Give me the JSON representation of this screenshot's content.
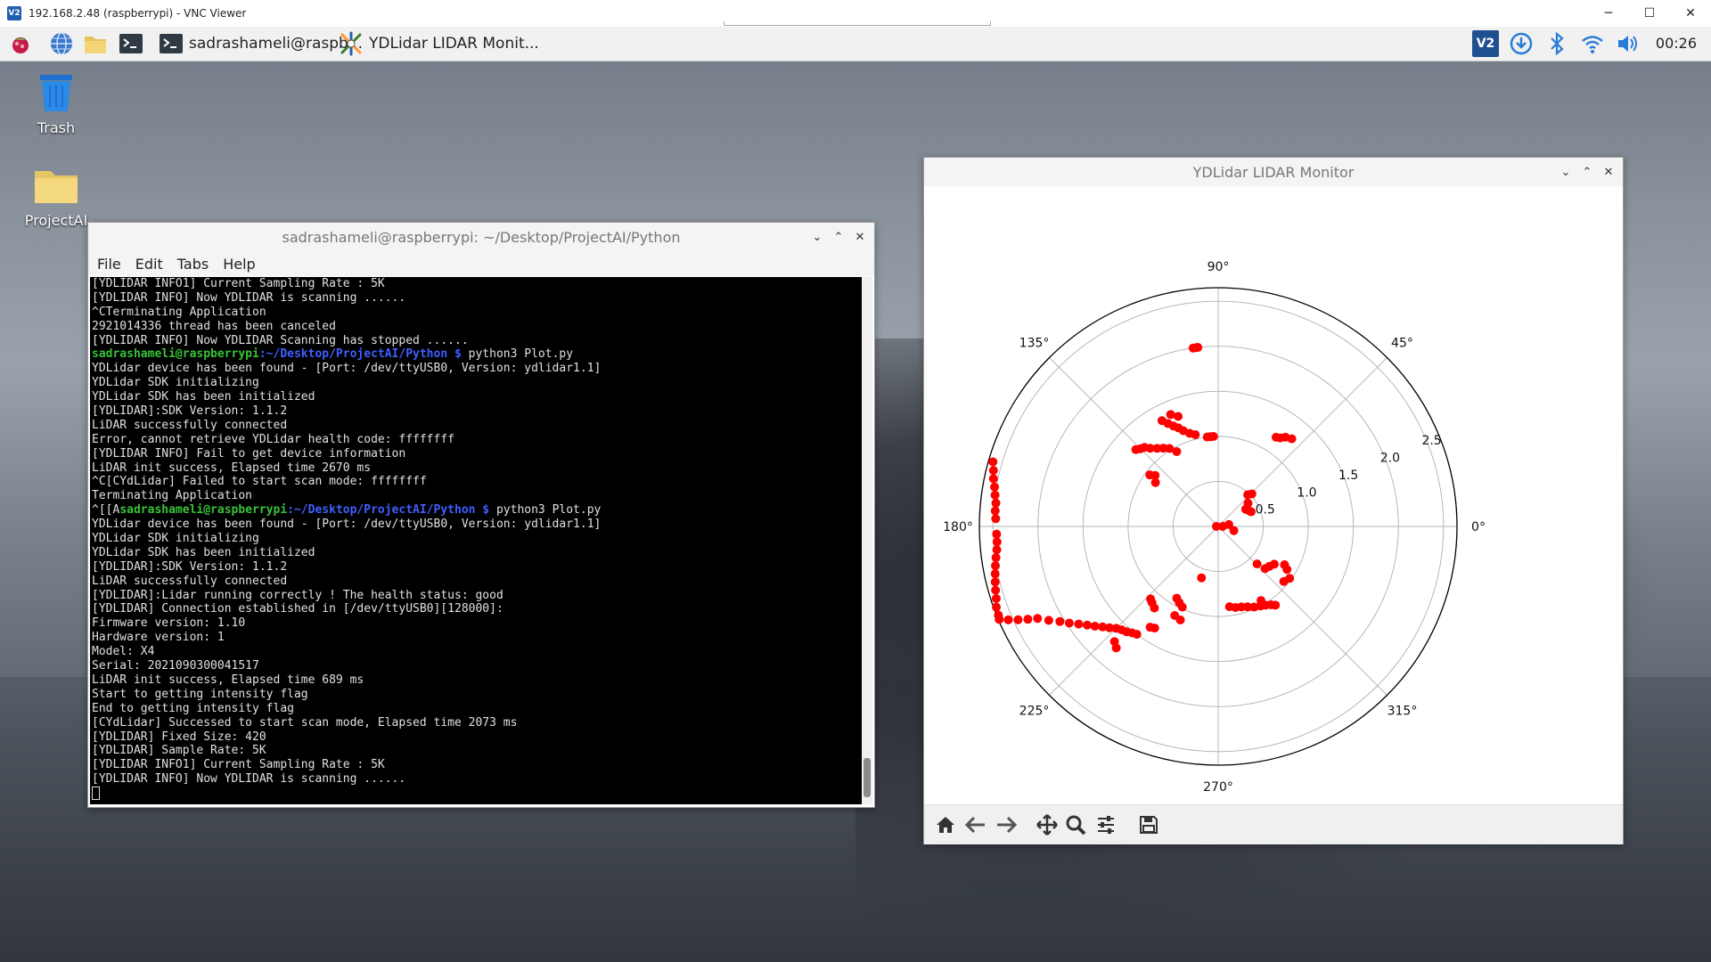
{
  "vnc": {
    "title": "192.168.2.48 (raspberrypi) - VNC Viewer",
    "logo": "V2",
    "controls": [
      "─",
      "☐",
      "✕"
    ]
  },
  "taskbar": {
    "tasks": [
      {
        "label": "sadrashameli@raspb...",
        "icon": "terminal-icon"
      },
      {
        "label": "YDLidar LIDAR Monit...",
        "icon": "python-icon"
      }
    ],
    "clock": "00:26",
    "tray_icons": [
      "vnc-icon",
      "download-icon",
      "bluetooth-icon",
      "wifi-icon",
      "volume-icon"
    ],
    "launcher_icons": [
      "raspberry-menu-icon",
      "browser-icon",
      "file-manager-icon",
      "terminal-launcher-icon"
    ]
  },
  "desktop": {
    "items": [
      {
        "label": "Trash",
        "icon": "trash-icon"
      },
      {
        "label": "ProjectAI",
        "icon": "folder-icon"
      }
    ]
  },
  "terminal": {
    "title": "sadrashameli@raspberrypi: ~/Desktop/ProjectAI/Python",
    "menu": [
      "File",
      "Edit",
      "Tabs",
      "Help"
    ],
    "lines": [
      {
        "text": "[YDLIDAR INFO1] Current Sampling Rate : 5K"
      },
      {
        "text": "[YDLIDAR INFO] Now YDLIDAR is scanning ......"
      },
      {
        "text": "^CTerminating Application"
      },
      {
        "text": "2921014336 thread has been canceled"
      },
      {
        "text": "[YDLIDAR INFO] Now YDLIDAR Scanning has stopped ......"
      },
      {
        "prefix": "",
        "user": "sadrashameli@raspberrypi",
        "path": ":~/Desktop/ProjectAI/Python $",
        "cmd": " python3 Plot.py"
      },
      {
        "text": "YDLidar device has been found - [Port: /dev/ttyUSB0, Version: ydlidar1.1]"
      },
      {
        "text": "YDLidar SDK initializing"
      },
      {
        "text": "YDLidar SDK has been initialized"
      },
      {
        "text": "[YDLIDAR]:SDK Version: 1.1.2"
      },
      {
        "text": "LiDAR successfully connected"
      },
      {
        "text": "Error, cannot retrieve YDLidar health code: ffffffff"
      },
      {
        "text": "[YDLIDAR INFO] Fail to get device information"
      },
      {
        "text": "LiDAR init success, Elapsed time 2670 ms"
      },
      {
        "text": "^C[CYdLidar] Failed to start scan mode: ffffffff"
      },
      {
        "text": "Terminating Application"
      },
      {
        "prefix": "^[[A",
        "user": "sadrashameli@raspberrypi",
        "path": ":~/Desktop/ProjectAI/Python $",
        "cmd": " python3 Plot.py"
      },
      {
        "text": "YDLidar device has been found - [Port: /dev/ttyUSB0, Version: ydlidar1.1]"
      },
      {
        "text": "YDLidar SDK initializing"
      },
      {
        "text": "YDLidar SDK has been initialized"
      },
      {
        "text": "[YDLIDAR]:SDK Version: 1.1.2"
      },
      {
        "text": "LiDAR successfully connected"
      },
      {
        "text": "[YDLIDAR]:Lidar running correctly ! The health status: good"
      },
      {
        "text": "[YDLIDAR] Connection established in [/dev/ttyUSB0][128000]:"
      },
      {
        "text": "Firmware version: 1.10"
      },
      {
        "text": "Hardware version: 1"
      },
      {
        "text": "Model: X4"
      },
      {
        "text": "Serial: 2021090300041517"
      },
      {
        "text": "LiDAR init success, Elapsed time 689 ms"
      },
      {
        "text": "Start to getting intensity flag"
      },
      {
        "text": "End to getting intensity flag"
      },
      {
        "text": "[CYdLidar] Successed to start scan mode, Elapsed time 2073 ms"
      },
      {
        "text": "[YDLIDAR] Fixed Size: 420"
      },
      {
        "text": "[YDLIDAR] Sample Rate: 5K"
      },
      {
        "text": "[YDLIDAR INFO1] Current Sampling Rate : 5K"
      },
      {
        "text": "[YDLIDAR INFO] Now YDLIDAR is scanning ......"
      }
    ]
  },
  "plot_window": {
    "title": "YDLidar LIDAR Monitor",
    "toolbar": [
      "home-icon",
      "back-arrow-icon",
      "forward-arrow-icon",
      "pan-icon",
      "zoom-icon",
      "configure-subplots-icon",
      "save-icon"
    ]
  },
  "chart_data": {
    "type": "scatter",
    "projection": "polar",
    "angle_labels": [
      "0°",
      "45°",
      "90°",
      "135°",
      "180°",
      "225°",
      "270°",
      "315°"
    ],
    "radial_ticks": [
      0.5,
      1.0,
      1.5,
      2.0,
      2.5
    ],
    "radial_tick_labels": [
      "0.5",
      "1.0",
      "1.5",
      "2.0",
      "2.5"
    ],
    "rlim": [
      0,
      2.65
    ],
    "grid": true,
    "marker_color": "#ff0000",
    "points": [
      [
        97,
        2.0
      ],
      [
        96.5,
        2.0
      ],
      [
        98,
        2.0
      ],
      [
        50,
        1.27
      ],
      [
        53,
        1.24
      ],
      [
        55,
        1.2
      ],
      [
        57,
        1.18
      ],
      [
        93,
        1.0
      ],
      [
        95,
        1.0
      ],
      [
        97,
        1.0
      ],
      [
        104,
        1.05
      ],
      [
        107,
        1.08
      ],
      [
        110,
        1.13
      ],
      [
        112,
        1.18
      ],
      [
        114,
        1.22
      ],
      [
        116,
        1.27
      ],
      [
        118,
        1.33
      ],
      [
        122,
        1.02
      ],
      [
        125,
        1.06
      ],
      [
        128,
        1.1
      ],
      [
        131,
        1.15
      ],
      [
        133,
        1.2
      ],
      [
        135,
        1.22
      ],
      [
        137,
        1.25
      ],
      [
        141,
        0.9
      ],
      [
        143,
        0.95
      ],
      [
        145,
        0.85
      ],
      [
        110,
        1.3
      ],
      [
        113,
        1.35
      ],
      [
        119,
        0.95
      ],
      [
        47,
        0.48
      ],
      [
        44,
        0.52
      ],
      [
        38,
        0.42
      ],
      [
        32,
        0.36
      ],
      [
        28,
        0.38
      ],
      [
        24,
        0.4
      ],
      [
        180,
        0.02
      ],
      [
        0,
        0.05
      ],
      [
        345,
        0.18
      ],
      [
        10,
        0.12
      ],
      [
        172,
        2.5
      ],
      [
        170,
        2.52
      ],
      [
        168,
        2.55
      ],
      [
        166,
        2.57
      ],
      [
        164,
        2.6
      ],
      [
        174,
        2.48
      ],
      [
        176,
        2.48
      ],
      [
        178,
        2.47
      ],
      [
        182,
        2.46
      ],
      [
        184,
        2.46
      ],
      [
        186,
        2.47
      ],
      [
        188,
        2.49
      ],
      [
        190,
        2.51
      ],
      [
        192,
        2.53
      ],
      [
        194,
        2.55
      ],
      [
        196,
        2.57
      ],
      [
        198,
        2.59
      ],
      [
        200,
        2.62
      ],
      [
        202,
        2.63
      ],
      [
        203,
        2.64
      ],
      [
        204,
        2.55
      ],
      [
        205,
        2.45
      ],
      [
        206,
        2.35
      ],
      [
        207,
        2.25
      ],
      [
        209,
        2.15
      ],
      [
        211,
        2.05
      ],
      [
        213,
        1.97
      ],
      [
        215,
        1.89
      ],
      [
        217,
        1.82
      ],
      [
        219,
        1.76
      ],
      [
        221,
        1.7
      ],
      [
        223,
        1.65
      ],
      [
        225,
        1.6
      ],
      [
        227,
        1.57
      ],
      [
        229,
        1.55
      ],
      [
        231,
        1.52
      ],
      [
        233,
        1.5
      ],
      [
        228,
        1.72
      ],
      [
        230,
        1.76
      ],
      [
        240,
        0.92
      ],
      [
        243,
        0.95
      ],
      [
        246,
        0.98
      ],
      [
        252,
        0.6
      ],
      [
        244,
        1.1
      ],
      [
        248,
        1.12
      ],
      [
        236,
        1.35
      ],
      [
        238,
        1.33
      ],
      [
        232,
        1.15
      ],
      [
        229,
        1.12
      ],
      [
        227,
        1.1
      ],
      [
        278,
        0.9
      ],
      [
        282,
        0.92
      ],
      [
        286,
        0.93
      ],
      [
        290,
        0.95
      ],
      [
        294,
        0.98
      ],
      [
        298,
        1.0
      ],
      [
        301,
        1.02
      ],
      [
        304,
        1.05
      ],
      [
        306,
        1.08
      ],
      [
        300,
        0.95
      ],
      [
        318,
        0.7
      ],
      [
        322,
        0.72
      ],
      [
        326,
        0.75
      ],
      [
        316,
        0.6
      ],
      [
        320,
        0.95
      ],
      [
        324,
        0.98
      ],
      [
        328,
        0.9
      ],
      [
        330,
        0.85
      ]
    ]
  }
}
